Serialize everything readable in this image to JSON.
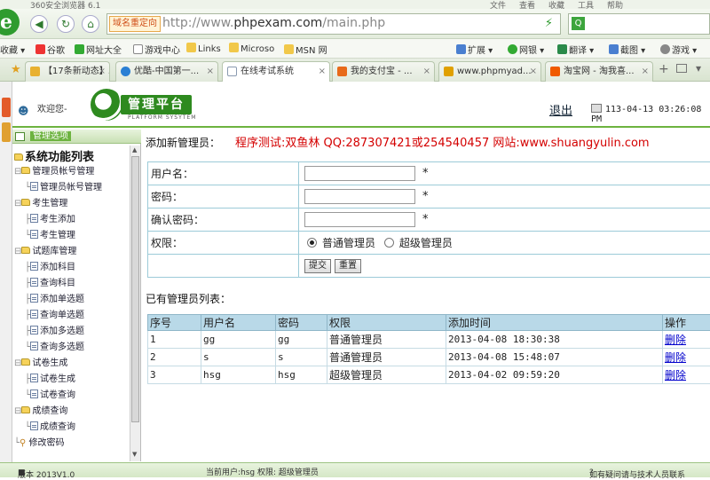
{
  "browser": {
    "title": "360安全浏览器 6.1",
    "menu": [
      "文件",
      "查看",
      "收藏",
      "工具",
      "帮助"
    ],
    "redirect_tag": "域名重定向",
    "url_prefix": "http://www.",
    "url_domain": "phpexam.com",
    "url_path": "/main.php",
    "favorites": [
      "收藏",
      "谷歌",
      "网址大全",
      "游戏中心",
      "Links",
      "Microso",
      "MSN 网"
    ],
    "tools": [
      "扩展",
      "网银",
      "翻译",
      "截图",
      "游戏"
    ],
    "tabs": [
      {
        "label": "【17条新动态】...",
        "color": "#e8b030",
        "active": false
      },
      {
        "label": "优酷-中国第一...",
        "color": "#2a7fd4",
        "active": false
      },
      {
        "label": "在线考试系统",
        "color": "#dde4ee",
        "active": true
      },
      {
        "label": "我的支付宝 - ...",
        "color": "#e86a1a",
        "active": false
      },
      {
        "label": "www.phpmyad...",
        "color": "#e0a000",
        "active": false
      },
      {
        "label": "淘宝网 - 淘我喜...",
        "color": "#f05a00",
        "active": false
      }
    ]
  },
  "header": {
    "welcome": "欢迎您-",
    "logo_title": "管理平台",
    "logo_sub": "PLATFORM SYSYTEM",
    "logout": "退出",
    "datetime": "113-04-13 03:26:08 PM"
  },
  "sidebar": {
    "header": "管理选项",
    "root": "系统功能列表",
    "groups": [
      {
        "label": "管理员帐号管理",
        "items": [
          "管理员帐号管理"
        ]
      },
      {
        "label": "考生管理",
        "items": [
          "考生添加",
          "考生管理"
        ]
      },
      {
        "label": "试题库管理",
        "items": [
          "添加科目",
          "查询科目",
          "添加单选题",
          "查询单选题",
          "添加多选题",
          "查询多选题"
        ]
      },
      {
        "label": "试卷生成",
        "items": [
          "试卷生成",
          "试卷查询"
        ]
      },
      {
        "label": "成绩查询",
        "items": [
          "成绩查询"
        ]
      }
    ],
    "last": "修改密码"
  },
  "main": {
    "add_title": "添加新管理员：",
    "test_info": "程序测试:双鱼林 QQ:287307421或254540457 网站:www.shuangyulin.com",
    "form": {
      "username_label": "用户名：",
      "password_label": "密码：",
      "confirm_label": "确认密码：",
      "perm_label": "权限：",
      "star": "*",
      "perm_normal": "普通管理员",
      "perm_super": "超级管理员",
      "submit": "提交",
      "reset": "重置"
    },
    "list_title": "已有管理员列表：",
    "columns": [
      "序号",
      "用户名",
      "密码",
      "权限",
      "添加时间",
      "操作"
    ],
    "rows": [
      {
        "id": "1",
        "user": "gg",
        "pwd": "gg",
        "perm": "普通管理员",
        "time": "2013-04-08 18:30:38",
        "op": "删除"
      },
      {
        "id": "2",
        "user": "s",
        "pwd": "s",
        "perm": "普通管理员",
        "time": "2013-04-08 15:48:07",
        "op": "删除"
      },
      {
        "id": "3",
        "user": "hsg",
        "pwd": "hsg",
        "perm": "超级管理员",
        "time": "2013-04-02 09:59:20",
        "op": "删除"
      }
    ]
  },
  "status": {
    "version": "版本 2013V1.0",
    "current_user": "当前用户:hsg 权限: 超级管理员",
    "help": "如有疑问请与技术人员联系"
  }
}
